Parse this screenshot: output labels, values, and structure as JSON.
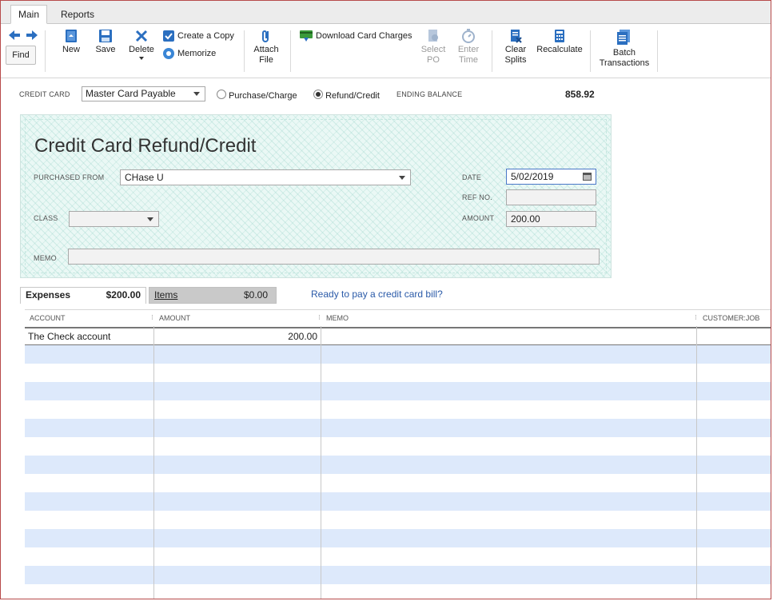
{
  "tabs": {
    "main": "Main",
    "reports": "Reports"
  },
  "toolbar": {
    "find": "Find",
    "new": "New",
    "save": "Save",
    "delete": "Delete",
    "create_copy": "Create a Copy",
    "memorize": "Memorize",
    "attach_file_1": "Attach",
    "attach_file_2": "File",
    "download_card_charges": "Download Card Charges",
    "select_po_1": "Select",
    "select_po_2": "PO",
    "enter_time_1": "Enter",
    "enter_time_2": "Time",
    "clear_splits_1": "Clear",
    "clear_splits_2": "Splits",
    "recalculate": "Recalculate",
    "batch_1": "Batch",
    "batch_2": "Transactions"
  },
  "cc": {
    "label": "CREDIT CARD",
    "account": "Master Card Payable",
    "radio_purchase": "Purchase/Charge",
    "radio_refund": "Refund/Credit",
    "ending_balance_label": "ENDING BALANCE",
    "ending_balance": "858.92"
  },
  "form": {
    "title": "Credit Card Refund/Credit",
    "purchased_from_label": "PURCHASED FROM",
    "purchased_from": "CHase U",
    "date_label": "DATE",
    "date": "5/02/2019",
    "ref_label": "REF NO.",
    "ref": "",
    "class_label": "CLASS",
    "class": "",
    "amount_label": "AMOUNT",
    "amount": "200.00",
    "memo_label": "MEMO",
    "memo": ""
  },
  "lower_tabs": {
    "expenses": "Expenses",
    "expenses_total": "$200.00",
    "items": "Items",
    "items_total": "$0.00",
    "link": "Ready to pay a credit card bill?"
  },
  "grid": {
    "headers": {
      "account": "ACCOUNT",
      "amount": "AMOUNT",
      "memo": "MEMO",
      "customer": "CUSTOMER:JOB"
    },
    "rows": [
      {
        "account": "The Check account",
        "amount": "200.00",
        "memo": "",
        "customer": ""
      }
    ]
  }
}
